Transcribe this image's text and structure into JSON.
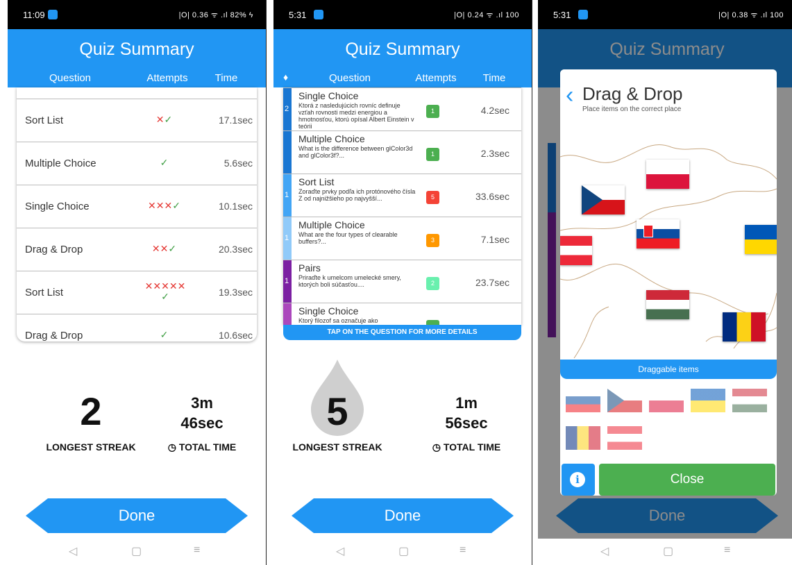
{
  "screens": [
    {
      "status": {
        "time": "11:09",
        "right": "|O| 0.36 ᯤ .ıl 82% ϟ"
      },
      "title": "Quiz Summary",
      "headers": {
        "question": "Question",
        "attempts": "Attempts",
        "time": "Time"
      },
      "rows": [
        {
          "question": "Sort List",
          "attempts": "✕✓",
          "time": "17.1sec"
        },
        {
          "question": "Multiple Choice",
          "attempts": "✓",
          "time": "5.6sec"
        },
        {
          "question": "Single Choice",
          "attempts": "✕✕✕✓",
          "time": "10.1sec"
        },
        {
          "question": "Drag & Drop",
          "attempts": "✕✕✓",
          "time": "20.3sec"
        },
        {
          "question": "Sort List",
          "attempts": "✕✕✕✕✕✓",
          "time": "19.3sec"
        },
        {
          "question": "Drag & Drop",
          "attempts": "✓",
          "time": "10.6sec"
        }
      ],
      "streak_value": "2",
      "streak_label": "LONGEST STREAK",
      "total_time_line1": "3m",
      "total_time_line2": "46sec",
      "total_time_label": "TOTAL TIME",
      "done_label": "Done"
    },
    {
      "status": {
        "time": "5:31",
        "right": "|O| 0.24 ᯤ .ıl 100"
      },
      "title": "Quiz Summary",
      "headers": {
        "question": "Question",
        "attempts": "Attempts",
        "time": "Time"
      },
      "rows": [
        {
          "stripe": "2",
          "question": "Single Choice",
          "detail": "Ktorá z nasledujúcich rovníc definuje vzťah rovnosti medzi energiou a hmotnosťou, ktorú opísal Albert Einstein v teórii",
          "attempts": "1",
          "time": "4.2sec",
          "color": "#1976d2",
          "badge": "#4caf50"
        },
        {
          "stripe": "",
          "question": "Multiple Choice",
          "detail": "What is the difference between glColor3d and glColor3f?...",
          "attempts": "1",
          "time": "2.3sec",
          "color": "#1976d2",
          "badge": "#4caf50"
        },
        {
          "stripe": "1",
          "question": "Sort List",
          "detail": "Zoraďte prvky podľa ich protónového čísla Z od najnižšieho po najvyšší...",
          "attempts": "5",
          "time": "33.6sec",
          "color": "#42a5f5",
          "badge": "#f44336"
        },
        {
          "stripe": "1",
          "question": "Multiple Choice",
          "detail": "What are the four types of clearable buffers?...",
          "attempts": "3",
          "time": "7.1sec",
          "color": "#90caf9",
          "badge": "#ff9800"
        },
        {
          "stripe": "1",
          "question": "Pairs",
          "detail": "Priraďte k umelcom umelecké smery, ktorých boli súčasťou....",
          "attempts": "2",
          "time": "23.7sec",
          "color": "#7b1fa2",
          "badge": "#69f0ae"
        },
        {
          "stripe": "",
          "question": "Single Choice",
          "detail": "Ktorý filozof sa označuje ako",
          "attempts": "",
          "time": "",
          "color": "#ab47bc",
          "badge": "#4caf50"
        }
      ],
      "tap_hint": "TAP ON THE QUESTION FOR MORE DETAILS",
      "streak_value": "5",
      "streak_label": "LONGEST STREAK",
      "total_time_line1": "1m",
      "total_time_line2": "56sec",
      "total_time_label": "TOTAL TIME",
      "done_label": "Done"
    },
    {
      "status": {
        "time": "5:31",
        "right": "|O| 0.38 ᯤ .ıl 100"
      },
      "title": "Quiz Summary",
      "modal_title": "Drag & Drop",
      "modal_subtitle": "Place items on the correct place",
      "draggable_label": "Draggable items",
      "info_label": "i",
      "close_label": "Close",
      "done_label": "Done"
    }
  ],
  "nav": {
    "back": "◁",
    "home": "▢",
    "menu": "≡"
  }
}
